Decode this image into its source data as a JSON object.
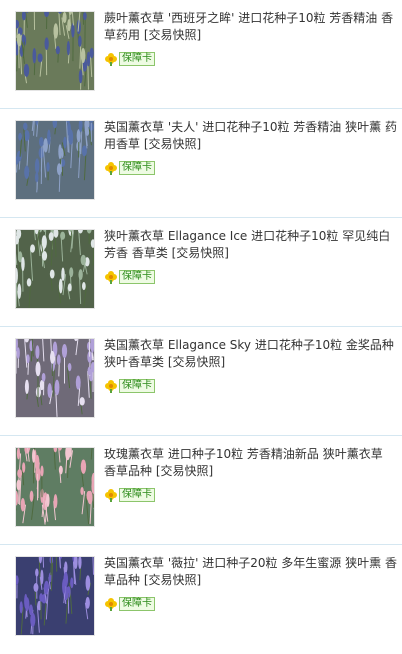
{
  "items": [
    {
      "title": "蕨叶薰衣草 '西班牙之眸' 进口花种子10粒 芳香精油 香草药用 [交易快照]",
      "badge": "保障卡",
      "image": "lavender-spanish-eyes-photo",
      "palette": {
        "bg": "#6a7a5a",
        "fg": "#4a5a9c",
        "accent": "#b8c2a0"
      }
    },
    {
      "title": "英国薰衣草 '夫人' 进口花种子10粒 芳香精油 狭叶薰 药用香草 [交易快照]",
      "badge": "保障卡",
      "image": "lavender-lady-photo",
      "palette": {
        "bg": "#5d6f7e",
        "fg": "#5872a9",
        "accent": "#8ea2c8"
      }
    },
    {
      "title": "狭叶薰衣草 Ellagance Ice 进口花种子10粒 罕见纯白芳香 香草类 [交易快照]",
      "badge": "保障卡",
      "image": "lavender-ellagance-ice-photo",
      "palette": {
        "bg": "#52634a",
        "fg": "#dfe6e6",
        "accent": "#9bb39a"
      }
    },
    {
      "title": "英国薰衣草 Ellagance Sky 进口花种子10粒 金奖品种狭叶香草类 [交易快照]",
      "badge": "保障卡",
      "image": "lavender-ellagance-sky-photo",
      "palette": {
        "bg": "#6f6a78",
        "fg": "#b0a0d8",
        "accent": "#e6e0f0"
      }
    },
    {
      "title": "玫瑰薰衣草 进口种子10粒 芳香精油新品 狭叶薰衣草 香草品种 [交易快照]",
      "badge": "保障卡",
      "image": "lavender-rose-photo",
      "palette": {
        "bg": "#5f7d63",
        "fg": "#e8a5b5",
        "accent": "#f3c7d1"
      }
    },
    {
      "title": "英国薰衣草 '薇拉' 进口种子20粒 多年生蜜源 狭叶熏 香草品种 [交易快照]",
      "badge": "保障卡",
      "image": "lavender-vera-photo",
      "palette": {
        "bg": "#3a3f70",
        "fg": "#6a5cc0",
        "accent": "#9d8ee0"
      }
    }
  ]
}
